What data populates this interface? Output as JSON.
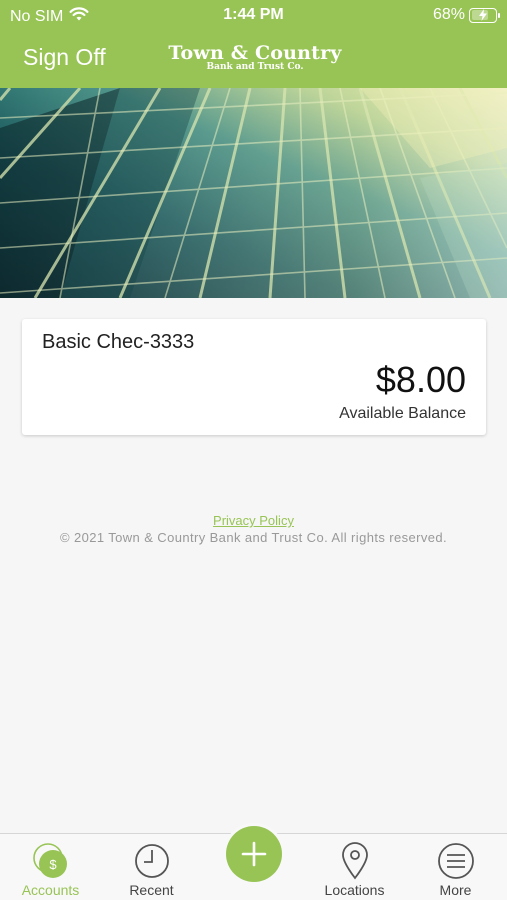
{
  "status_bar": {
    "carrier": "No SIM",
    "time": "1:44 PM",
    "battery_percent": "68%",
    "wifi_icon": "wifi-icon",
    "battery_icon": "battery-charging-icon"
  },
  "nav": {
    "sign_off_label": "Sign Off",
    "logo_line1": "Town & Country",
    "logo_line2": "Bank and Trust Co."
  },
  "account": {
    "name": "Basic Chec-3333",
    "balance": "$8.00",
    "balance_label": "Available Balance"
  },
  "footer": {
    "privacy_label": "Privacy Policy",
    "copyright": "© 2021 Town & Country Bank and Trust Co. All rights reserved."
  },
  "tabs": [
    {
      "label": "Accounts",
      "icon": "dollar-coin-icon",
      "active": true
    },
    {
      "label": "Recent",
      "icon": "clock-icon",
      "active": false
    },
    {
      "label": "",
      "icon": "plus-icon",
      "active": false
    },
    {
      "label": "Locations",
      "icon": "map-pin-icon",
      "active": false
    },
    {
      "label": "More",
      "icon": "menu-lines-icon",
      "active": false
    }
  ],
  "colors": {
    "brand_green": "#98c456",
    "background": "#f6f6f6"
  }
}
